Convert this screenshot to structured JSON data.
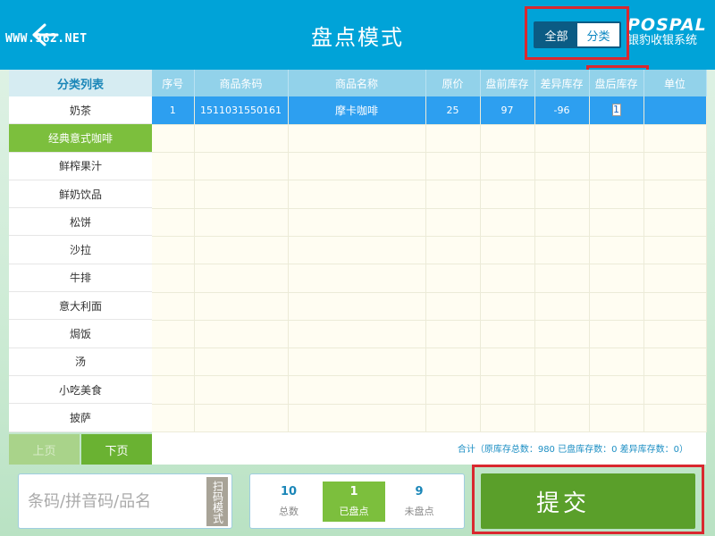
{
  "header": {
    "title": "盘点模式",
    "watermark": "WWW.962.NET",
    "mode_all": "全部",
    "mode_category": "分类",
    "logo_en": "POSPAL",
    "logo_cn": "银豹收银系统"
  },
  "sidebar": {
    "header": "分类列表",
    "items": [
      {
        "label": "奶茶"
      },
      {
        "label": "经典意式咖啡",
        "active": true
      },
      {
        "label": "鲜榨果汁"
      },
      {
        "label": "鲜奶饮品"
      },
      {
        "label": "松饼"
      },
      {
        "label": "沙拉"
      },
      {
        "label": "牛排"
      },
      {
        "label": "意大利面"
      },
      {
        "label": "焗饭"
      },
      {
        "label": "汤"
      },
      {
        "label": "小吃美食"
      },
      {
        "label": "披萨"
      }
    ],
    "prev_label": "上页",
    "next_label": "下页"
  },
  "table": {
    "columns": [
      "序号",
      "商品条码",
      "商品名称",
      "原价",
      "盘前库存",
      "差异库存",
      "盘后库存",
      "单位"
    ],
    "rows": [
      [
        "1",
        "1511031550161",
        "摩卡咖啡",
        "25",
        "97",
        "-96",
        "1",
        ""
      ]
    ],
    "summary": "合计（原库存总数：980 已盘库存数：0 差异库存数：0）"
  },
  "search": {
    "placeholder": "条码/拼音码/品名",
    "scan_label": "扫码模式"
  },
  "stats": {
    "total": {
      "value": "10",
      "label": "总数"
    },
    "counted": {
      "value": "1",
      "label": "已盘点"
    },
    "uncounted": {
      "value": "9",
      "label": "未盘点"
    }
  },
  "submit_label": "提交",
  "colors": {
    "header_bg": "#00a3d8",
    "accent_green": "#7cbf3d",
    "highlight_red": "#d9282f",
    "selected_row": "#2d9ff0"
  }
}
